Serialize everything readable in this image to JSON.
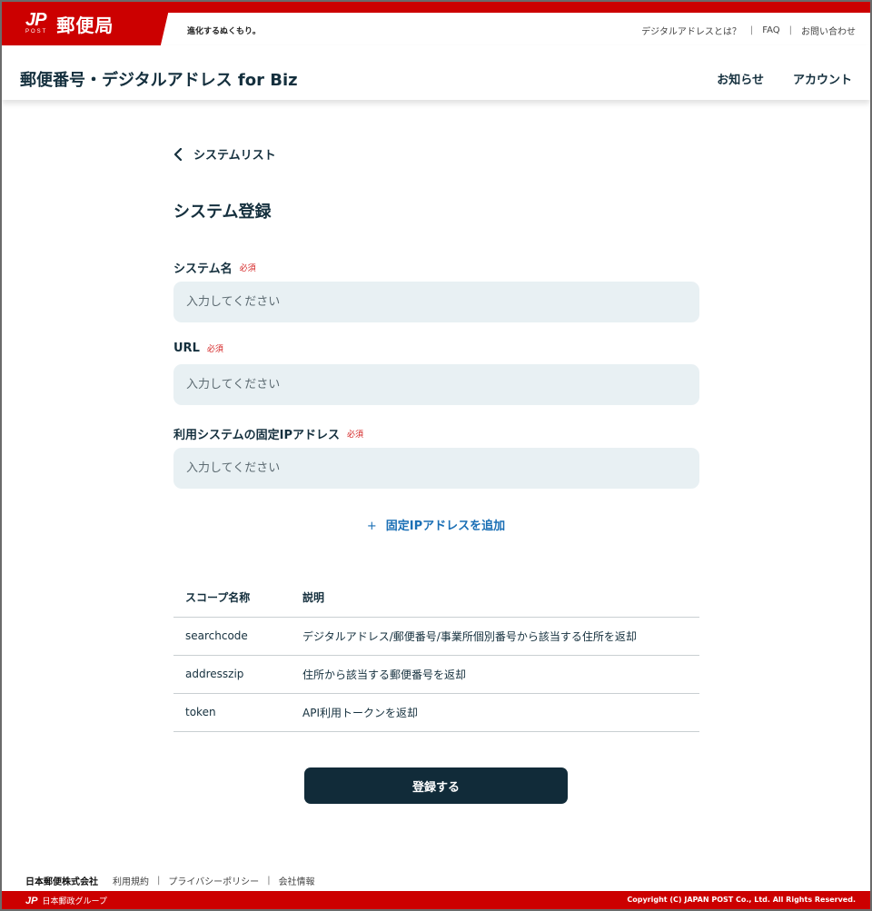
{
  "brand": {
    "logo_text": "JP",
    "logo_sub": "POST",
    "name": "郵便局",
    "tagline": "進化するぬくもり。"
  },
  "utility_links": [
    "デジタルアドレスとは？",
    "FAQ",
    "お問い合わせ"
  ],
  "header": {
    "service_title": "郵便番号・デジタルアドレス for Biz",
    "nav": [
      "お知らせ",
      "アカウント"
    ]
  },
  "back_link": "システムリスト",
  "page_title": "システム登録",
  "form": {
    "required_badge": "必須",
    "fields": [
      {
        "label": "システム名",
        "placeholder": "入力してください",
        "value": ""
      },
      {
        "label": "URL",
        "placeholder": "入力してください",
        "value": ""
      },
      {
        "label": "利用システムの固定IPアドレス",
        "placeholder": "入力してください",
        "value": ""
      }
    ],
    "add_ip_label": "固定IPアドレスを追加",
    "add_ip_icon": "+"
  },
  "scope_table": {
    "headers": [
      "スコープ名称",
      "説明"
    ],
    "rows": [
      {
        "name": "searchcode",
        "description": "デジタルアドレス/郵便番号/事業所個別番号から該当する住所を返却"
      },
      {
        "name": "addresszip",
        "description": "住所から該当する郵便番号を返却"
      },
      {
        "name": "token",
        "description": "API利用トークンを返却"
      }
    ]
  },
  "submit_label": "登録する",
  "footer": {
    "company": "日本郵便株式会社",
    "links": [
      "利用規約",
      "プライバシーポリシー",
      "会社情報"
    ],
    "group_mark": "JP",
    "group_label": "日本郵政グループ",
    "copyright": "Copyright (C) JAPAN POST Co., Ltd. All Rights Reserved."
  },
  "colors": {
    "brand_red": "#cc0000",
    "primary_dark": "#112b39",
    "input_bg": "#e8f0f3",
    "link_blue": "#1a6fb5",
    "required_red": "#d32020"
  }
}
